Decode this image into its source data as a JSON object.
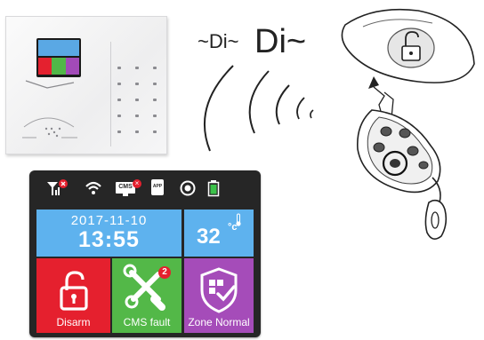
{
  "sound_effect": {
    "small": "~Di~",
    "large": "Di~"
  },
  "status_bar": {
    "icons": [
      "signal-no-sim-icon",
      "wifi-icon",
      "cms-disconnected-icon",
      "app-icon",
      "record-icon",
      "battery-icon"
    ],
    "cms_badge": "CMS",
    "app_badge": "APP"
  },
  "datetime": {
    "date": "2017-11-10",
    "time": "13:55"
  },
  "temperature": {
    "value": "32",
    "unit": "°c"
  },
  "tiles": {
    "disarm": {
      "label": "Disarm",
      "color": "#e5202e",
      "icon": "unlock-icon"
    },
    "cms": {
      "label": "CMS fault",
      "color": "#53b848",
      "icon": "tools-icon",
      "badge": "2"
    },
    "zone": {
      "label": "Zone Normal",
      "color": "#a54cb9",
      "icon": "shield-check-icon"
    }
  },
  "colors": {
    "sky_tile": "#5eb2ee",
    "screen_bg": "#262626"
  }
}
